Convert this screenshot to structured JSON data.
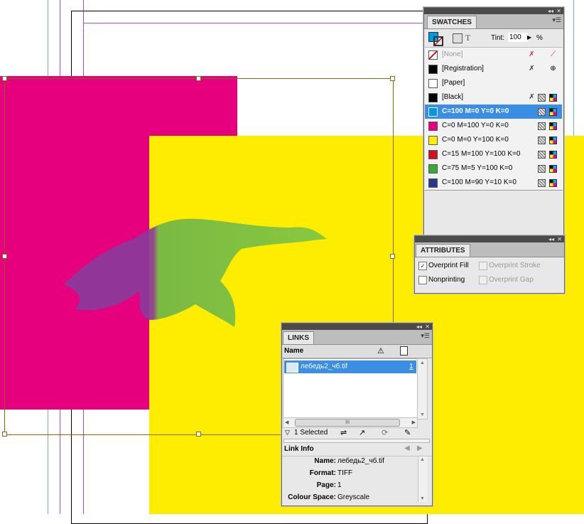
{
  "swatches": {
    "title": "SWATCHES",
    "tint_label": "Tint:",
    "tint_value": "100",
    "tint_unit": "%",
    "items": [
      {
        "name": "[None]",
        "color": "#ffffff",
        "kind": "none",
        "disabled": true
      },
      {
        "name": "[Registration]",
        "color": "#000000",
        "kind": "registration"
      },
      {
        "name": "[Paper]",
        "color": "#ffffff",
        "kind": "paper"
      },
      {
        "name": "[Black]",
        "color": "#000000",
        "kind": "black"
      },
      {
        "name": "C=100 M=0 Y=0 K=0",
        "color": "#0098e0",
        "kind": "process",
        "selected": true
      },
      {
        "name": "C=0 M=100 Y=0 K=0",
        "color": "#e6007e",
        "kind": "process"
      },
      {
        "name": "C=0 M=0 Y=100 K=0",
        "color": "#ffed00",
        "kind": "process"
      },
      {
        "name": "C=15 M=100 Y=100 K=0",
        "color": "#d0101e",
        "kind": "process"
      },
      {
        "name": "C=75 M=5 Y=100 K=0",
        "color": "#3aa935",
        "kind": "process"
      },
      {
        "name": "C=100 M=90 Y=10 K=0",
        "color": "#263a8a",
        "kind": "process"
      }
    ]
  },
  "attributes": {
    "title": "ATTRIBUTES",
    "overprint_fill": "Overprint Fill",
    "overprint_stroke": "Overprint Stroke",
    "nonprinting": "Nonprinting",
    "overprint_gap": "Overprint Gap"
  },
  "links": {
    "title": "LINKS",
    "col_name": "Name",
    "file_name": "лебедь2_чб.tif",
    "file_page": "1",
    "selected_count": "1 Selected",
    "link_info_title": "Link Info",
    "info": [
      {
        "label": "Name:",
        "value": "лебедь2_чб.tif"
      },
      {
        "label": "Format:",
        "value": "TIFF"
      },
      {
        "label": "Page:",
        "value": "1"
      },
      {
        "label": "Colour Space:",
        "value": "Greyscale"
      }
    ]
  },
  "colors": {
    "magenta": "#e6007e",
    "yellow": "#ffed00",
    "swan_green": "#74c043",
    "selection": "#3a8ee6",
    "frame": "#8a6414"
  }
}
